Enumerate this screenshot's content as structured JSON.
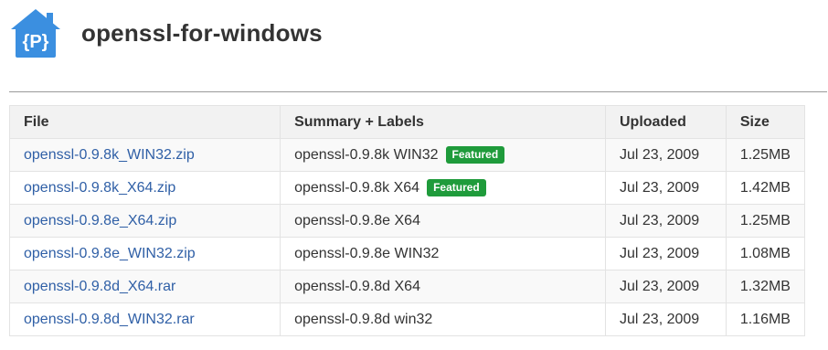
{
  "project": {
    "title": "openssl-for-windows",
    "logo_icon": "project-house-logo",
    "logo_letter": "{P}",
    "logo_color": "#3b8fe0"
  },
  "table": {
    "headers": {
      "file": "File",
      "summary": "Summary + Labels",
      "uploaded": "Uploaded",
      "size": "Size"
    },
    "rows": [
      {
        "file": "openssl-0.9.8k_WIN32.zip",
        "summary": "openssl-0.9.8k WIN32",
        "label": "Featured",
        "uploaded": "Jul 23, 2009",
        "size": "1.25MB"
      },
      {
        "file": "openssl-0.9.8k_X64.zip",
        "summary": "openssl-0.9.8k X64",
        "label": "Featured",
        "uploaded": "Jul 23, 2009",
        "size": "1.42MB"
      },
      {
        "file": "openssl-0.9.8e_X64.zip",
        "summary": "openssl-0.9.8e X64",
        "label": "",
        "uploaded": "Jul 23, 2009",
        "size": "1.25MB"
      },
      {
        "file": "openssl-0.9.8e_WIN32.zip",
        "summary": "openssl-0.9.8e WIN32",
        "label": "",
        "uploaded": "Jul 23, 2009",
        "size": "1.08MB"
      },
      {
        "file": "openssl-0.9.8d_X64.rar",
        "summary": "openssl-0.9.8d X64",
        "label": "",
        "uploaded": "Jul 23, 2009",
        "size": "1.32MB"
      },
      {
        "file": "openssl-0.9.8d_WIN32.rar",
        "summary": "openssl-0.9.8d win32",
        "label": "",
        "uploaded": "Jul 23, 2009",
        "size": "1.16MB"
      }
    ]
  },
  "colors": {
    "link": "#2f5fa6",
    "featured_badge": "#1f9b3b"
  }
}
